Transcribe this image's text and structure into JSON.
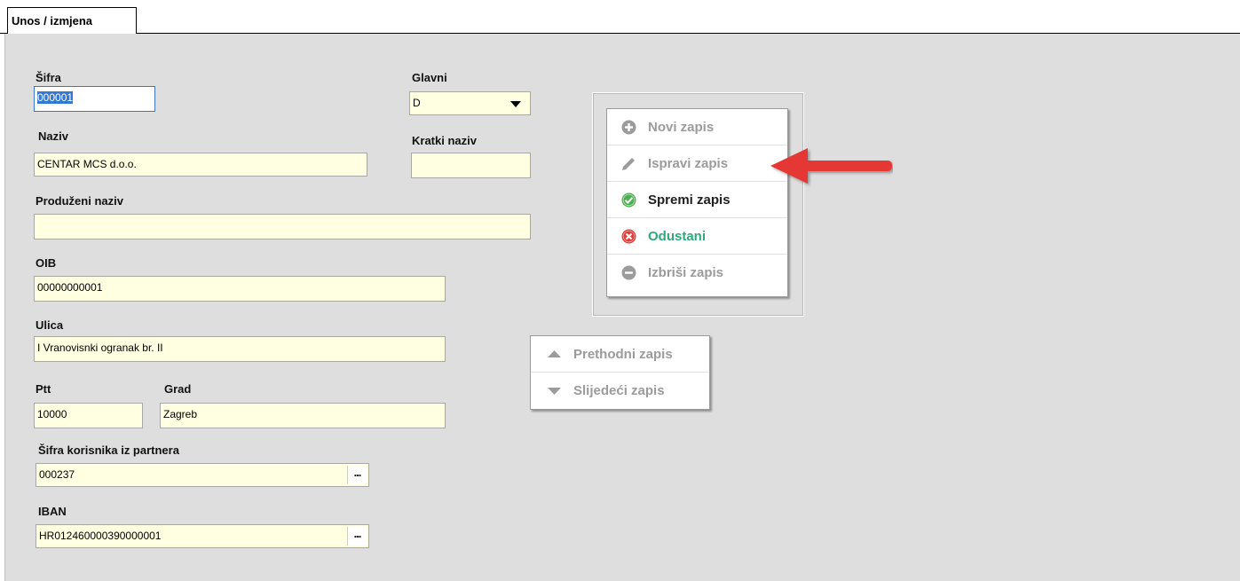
{
  "tab": {
    "label": "Unos / izmjena"
  },
  "form": {
    "sifra": {
      "label": "Šifra",
      "value": "000001"
    },
    "glavni": {
      "label": "Glavni",
      "value": "D"
    },
    "naziv": {
      "label": "Naziv",
      "value": "CENTAR MCS d.o.o."
    },
    "kratki_naziv": {
      "label": "Kratki naziv",
      "value": ""
    },
    "produzeni_naziv": {
      "label": "Produženi naziv",
      "value": ""
    },
    "oib": {
      "label": "OIB",
      "value": "00000000001"
    },
    "ulica": {
      "label": "Ulica",
      "value": "I Vranovisnki ogranak br. II"
    },
    "ptt": {
      "label": "Ptt",
      "value": "10000"
    },
    "grad": {
      "label": "Grad",
      "value": "Zagreb"
    },
    "sifra_korisnika": {
      "label": "Šifra korisnika iz partnera",
      "value": "000237",
      "button": "..."
    },
    "iban": {
      "label": "IBAN",
      "value": "HR012460000390000001",
      "button": "..."
    }
  },
  "actions": {
    "new": {
      "label": "Novi zapis",
      "icon": "plus-circle-icon",
      "enabled": false
    },
    "edit": {
      "label": "Ispravi zapis",
      "icon": "pencil-icon",
      "enabled": false
    },
    "save": {
      "label": "Spremi zapis",
      "icon": "check-circle-icon",
      "enabled": true
    },
    "cancel": {
      "label": "Odustani",
      "icon": "x-circle-icon",
      "enabled": true
    },
    "delete": {
      "label": "Izbriši zapis",
      "icon": "minus-circle-icon",
      "enabled": false
    }
  },
  "navigation": {
    "prev": {
      "label": "Prethodni zapis",
      "icon": "triangle-up-icon"
    },
    "next": {
      "label": "Slijedeći zapis",
      "icon": "triangle-down-icon"
    }
  },
  "colors": {
    "field_bg": "#ffffe1",
    "panel_bg": "#dedede",
    "disabled_text": "#9b9b9b",
    "save_icon": "#4caf50",
    "cancel_icon": "#e53935",
    "cancel_text": "#2eaa7a",
    "annotation_arrow": "#e53935"
  }
}
